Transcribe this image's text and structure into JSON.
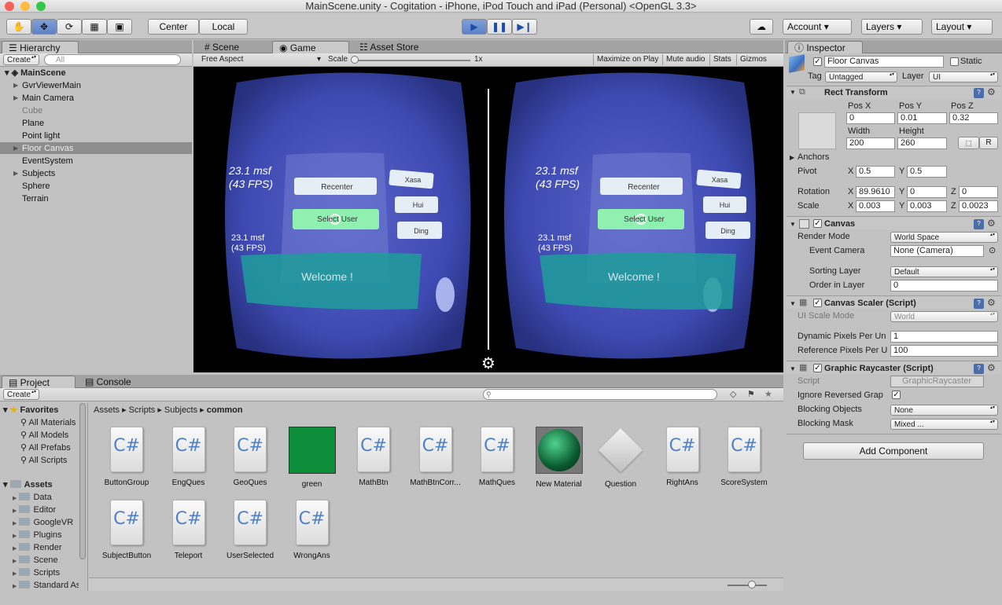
{
  "window": {
    "title": "MainScene.unity - Cogitation - iPhone, iPod Touch and iPad (Personal) <OpenGL 3.3>"
  },
  "toolbar": {
    "pivot": "Center",
    "space": "Local",
    "account": "Account",
    "layers": "Layers",
    "layout": "Layout",
    "icons": [
      "hand-icon",
      "move-icon",
      "rotate-icon",
      "scale-icon",
      "rect-icon",
      "play-icon",
      "pause-icon",
      "step-icon",
      "cloud-icon"
    ]
  },
  "hierarchy": {
    "tab": "Hierarchy",
    "create": "Create",
    "search_placeholder": "All",
    "scene": "MainScene",
    "items": [
      "GvrViewerMain",
      "Main Camera",
      "Cube",
      "Plane",
      "Point light",
      "Floor Canvas",
      "EventSystem",
      "Subjects",
      "Sphere",
      "Terrain"
    ]
  },
  "game": {
    "tabs": [
      "Scene",
      "Game",
      "Asset Store"
    ],
    "aspect": "Free Aspect",
    "scale_label": "Scale",
    "scale_value": "1x",
    "toggles": [
      "Maximize on Play",
      "Mute audio",
      "Stats",
      "Gizmos"
    ],
    "eye": {
      "fps_big": "23.1 msf\n(43 FPS)",
      "fps_small": "23.1 msf\n(43 FPS)",
      "btn_recenter": "Recenter",
      "btn_select": "Select User",
      "btn_xasa": "Xasa",
      "btn_hui": "Hui",
      "btn_ding": "Ding",
      "welcome": "Welcome !"
    }
  },
  "project": {
    "tabs": [
      "Project",
      "Console"
    ],
    "create": "Create",
    "breadcrumb": [
      "Assets",
      "Scripts",
      "Subjects",
      "common"
    ],
    "favorites_label": "Favorites",
    "favorites": [
      "All Materials",
      "All Models",
      "All Prefabs",
      "All Scripts"
    ],
    "assets_label": "Assets",
    "folders": [
      "Data",
      "Editor",
      "GoogleVR",
      "Plugins",
      "Render",
      "Scene",
      "Scripts",
      "Standard Assets"
    ],
    "assets": [
      "ButtonGroup",
      "EngQues",
      "GeoQues",
      "green",
      "MathBtn",
      "MathBtnCorr...",
      "MathQues",
      "New Material",
      "Question",
      "RightAns",
      "ScoreSystem",
      "SubjectButton",
      "Teleport",
      "UserSelected",
      "WrongAns"
    ]
  },
  "inspector": {
    "tab": "Inspector",
    "object_name": "Floor Canvas",
    "static": "Static",
    "tag_label": "Tag",
    "tag": "Untagged",
    "layer_label": "Layer",
    "layer": "UI",
    "rect": {
      "title": "Rect Transform",
      "pos_x_label": "Pos X",
      "pos_y_label": "Pos Y",
      "pos_z_label": "Pos Z",
      "pos_x": "0",
      "pos_y": "0.01",
      "pos_z": "0.32",
      "width_label": "Width",
      "height_label": "Height",
      "width": "200",
      "height": "260",
      "anchors": "Anchors",
      "pivot": "Pivot",
      "pivot_x": "0.5",
      "pivot_y": "0.5",
      "rotation": "Rotation",
      "rot_x": "89.9610",
      "rot_y": "0",
      "rot_z": "0",
      "scale": "Scale",
      "scale_x": "0.003",
      "scale_y": "0.003",
      "scale_z": "0.0023",
      "r_label": "R"
    },
    "canvas": {
      "title": "Canvas",
      "render_mode_label": "Render Mode",
      "render_mode": "World Space",
      "event_camera_label": "Event Camera",
      "event_camera": "None (Camera)",
      "sorting_layer_label": "Sorting Layer",
      "sorting_layer": "Default",
      "order_label": "Order in Layer",
      "order": "0"
    },
    "scaler": {
      "title": "Canvas Scaler (Script)",
      "ui_scale_label": "UI Scale Mode",
      "ui_scale": "World",
      "dpu_label": "Dynamic Pixels Per Un",
      "dpu": "1",
      "rpu_label": "Reference Pixels Per U",
      "rpu": "100"
    },
    "raycaster": {
      "title": "Graphic Raycaster (Script)",
      "script_label": "Script",
      "script": "GraphicRaycaster",
      "ignore_label": "Ignore Reversed Grap",
      "blocking_objects_label": "Blocking Objects",
      "blocking_objects": "None",
      "blocking_mask_label": "Blocking Mask",
      "blocking_mask": "Mixed ..."
    },
    "add_component": "Add Component"
  }
}
